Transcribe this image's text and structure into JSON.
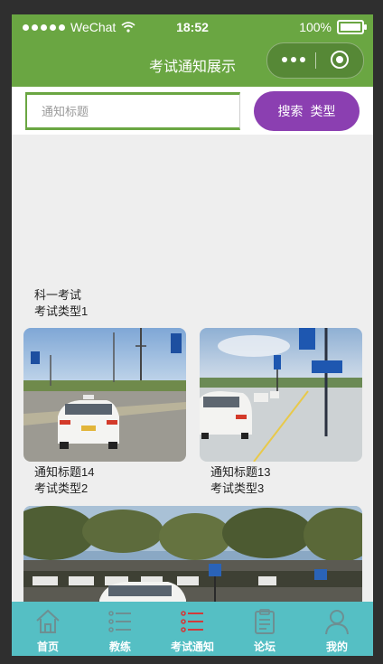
{
  "status": {
    "carrier": "WeChat",
    "time": "18:52",
    "battery": "100%"
  },
  "nav": {
    "title": "考试通知展示"
  },
  "search": {
    "placeholder": "通知标题",
    "search_label": "搜索",
    "type_label": "类型"
  },
  "notices": [
    {
      "title": "科一考试",
      "type": "考试类型1"
    },
    {
      "title": "通知标题14",
      "type": "考试类型2"
    },
    {
      "title": "通知标题13",
      "type": "考试类型3"
    }
  ],
  "tabs": [
    {
      "label": "首页",
      "icon": "home-icon",
      "active": false
    },
    {
      "label": "教练",
      "icon": "list-icon",
      "active": false
    },
    {
      "label": "考试通知",
      "icon": "notice-list-icon",
      "active": true
    },
    {
      "label": "论坛",
      "icon": "clipboard-icon",
      "active": false
    },
    {
      "label": "我的",
      "icon": "user-icon",
      "active": false
    }
  ],
  "colors": {
    "accent": "#6aa642",
    "button": "#8b3fb1",
    "tabbar": "#55bfc4",
    "tab_active_icon": "#d23a3a",
    "tab_icon": "#6d8f92"
  }
}
